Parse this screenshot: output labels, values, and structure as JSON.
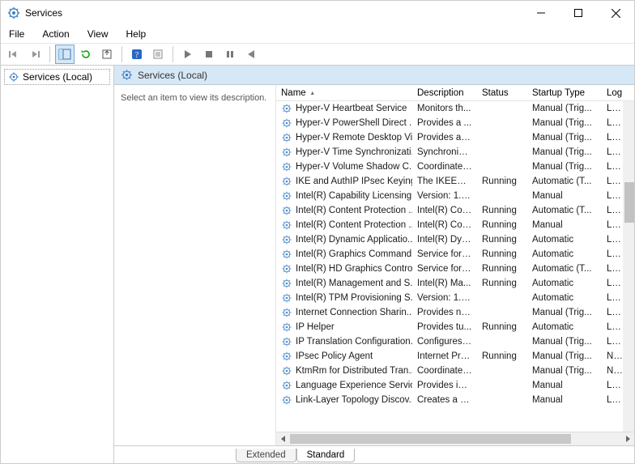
{
  "window": {
    "title": "Services"
  },
  "menu": [
    "File",
    "Action",
    "View",
    "Help"
  ],
  "tree": {
    "root": "Services (Local)"
  },
  "pane": {
    "header": "Services (Local)",
    "desc_prompt": "Select an item to view its description."
  },
  "columns": [
    "Name",
    "Description",
    "Status",
    "Startup Type",
    "Log"
  ],
  "services": [
    {
      "name": "Hyper-V Heartbeat Service",
      "desc": "Monitors th...",
      "status": "",
      "startup": "Manual (Trig...",
      "logon": "Loca"
    },
    {
      "name": "Hyper-V PowerShell Direct ...",
      "desc": "Provides a ...",
      "status": "",
      "startup": "Manual (Trig...",
      "logon": "Loca"
    },
    {
      "name": "Hyper-V Remote Desktop Vi...",
      "desc": "Provides a p...",
      "status": "",
      "startup": "Manual (Trig...",
      "logon": "Loca"
    },
    {
      "name": "Hyper-V Time Synchronizati...",
      "desc": "Synchronize...",
      "status": "",
      "startup": "Manual (Trig...",
      "logon": "Loca"
    },
    {
      "name": "Hyper-V Volume Shadow C...",
      "desc": "Coordinates...",
      "status": "",
      "startup": "Manual (Trig...",
      "logon": "Loca"
    },
    {
      "name": "IKE and AuthIP IPsec Keying...",
      "desc": "The IKEEXT ...",
      "status": "Running",
      "startup": "Automatic (T...",
      "logon": "Loca"
    },
    {
      "name": "Intel(R) Capability Licensing...",
      "desc": "Version: 1.6...",
      "status": "",
      "startup": "Manual",
      "logon": "Loca"
    },
    {
      "name": "Intel(R) Content Protection ...",
      "desc": "Intel(R) Con...",
      "status": "Running",
      "startup": "Automatic (T...",
      "logon": "Loca"
    },
    {
      "name": "Intel(R) Content Protection ...",
      "desc": "Intel(R) Con...",
      "status": "Running",
      "startup": "Manual",
      "logon": "Loca"
    },
    {
      "name": "Intel(R) Dynamic Applicatio...",
      "desc": "Intel(R) Dyn...",
      "status": "Running",
      "startup": "Automatic",
      "logon": "Loca"
    },
    {
      "name": "Intel(R) Graphics Command...",
      "desc": "Service for I...",
      "status": "Running",
      "startup": "Automatic",
      "logon": "Loca"
    },
    {
      "name": "Intel(R) HD Graphics Contro...",
      "desc": "Service for I...",
      "status": "Running",
      "startup": "Automatic (T...",
      "logon": "Loca"
    },
    {
      "name": "Intel(R) Management and S...",
      "desc": "Intel(R) Ma...",
      "status": "Running",
      "startup": "Automatic",
      "logon": "Loca"
    },
    {
      "name": "Intel(R) TPM Provisioning S...",
      "desc": "Version: 1.6...",
      "status": "",
      "startup": "Automatic",
      "logon": "Loca"
    },
    {
      "name": "Internet Connection Sharin...",
      "desc": "Provides ne...",
      "status": "",
      "startup": "Manual (Trig...",
      "logon": "Loca"
    },
    {
      "name": "IP Helper",
      "desc": "Provides tu...",
      "status": "Running",
      "startup": "Automatic",
      "logon": "Loca"
    },
    {
      "name": "IP Translation Configuration...",
      "desc": "Configures ...",
      "status": "",
      "startup": "Manual (Trig...",
      "logon": "Loca"
    },
    {
      "name": "IPsec Policy Agent",
      "desc": "Internet Pro...",
      "status": "Running",
      "startup": "Manual (Trig...",
      "logon": "Netv"
    },
    {
      "name": "KtmRm for Distributed Tran...",
      "desc": "Coordinates...",
      "status": "",
      "startup": "Manual (Trig...",
      "logon": "Netv"
    },
    {
      "name": "Language Experience Service",
      "desc": "Provides inf...",
      "status": "",
      "startup": "Manual",
      "logon": "Loca"
    },
    {
      "name": "Link-Layer Topology Discov...",
      "desc": "Creates a N...",
      "status": "",
      "startup": "Manual",
      "logon": "Loca"
    }
  ],
  "tabs": {
    "extended": "Extended",
    "standard": "Standard"
  }
}
